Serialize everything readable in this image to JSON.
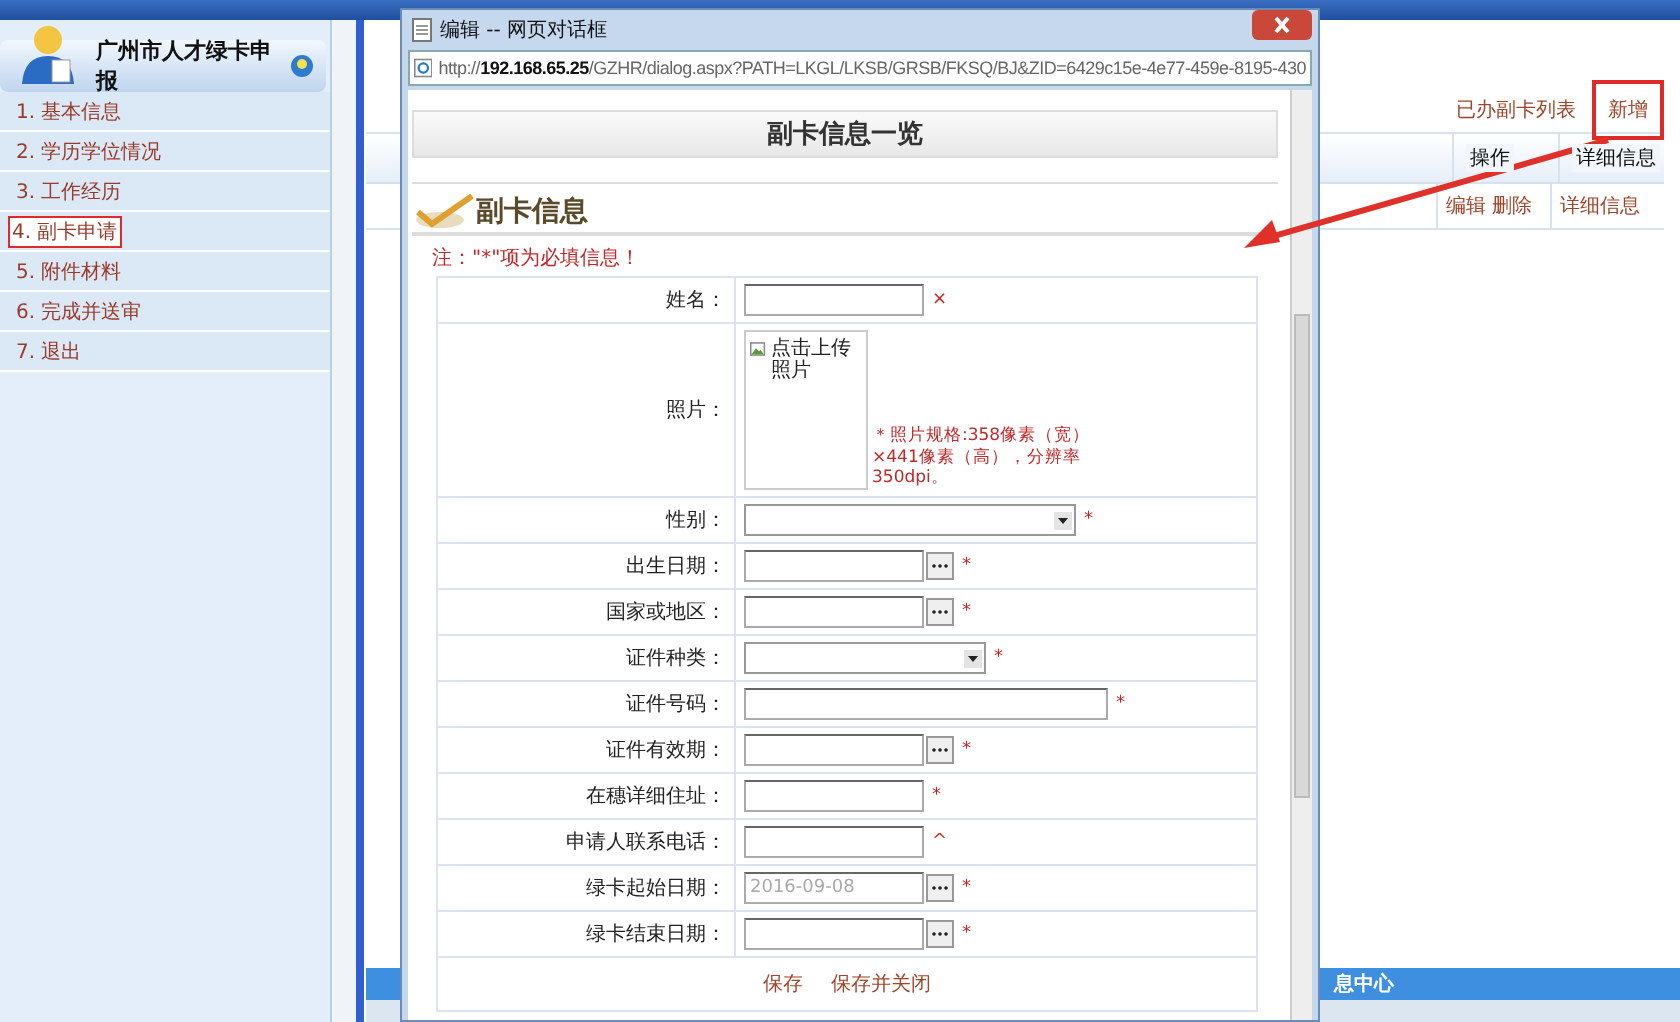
{
  "sidebar": {
    "title": "广州市人才绿卡申报",
    "items": [
      {
        "label": "1. 基本信息",
        "selected": false
      },
      {
        "label": "2. 学历学位情况",
        "selected": false
      },
      {
        "label": "3. 工作经历",
        "selected": false
      },
      {
        "label": "4. 副卡申请",
        "selected": true
      },
      {
        "label": "5. 附件材料",
        "selected": false
      },
      {
        "label": "6. 完成并送审",
        "selected": false
      },
      {
        "label": "7. 退出",
        "selected": false
      }
    ]
  },
  "main": {
    "list_title": "已办副卡列表",
    "add_link": "新增",
    "columns": [
      "操作",
      "详细信息"
    ],
    "rows": [
      {
        "actions": [
          "编辑",
          "删除"
        ],
        "detail": "详细信息"
      }
    ],
    "status_bar": "息中心"
  },
  "dialog": {
    "title": "编辑 -- 网页对话框",
    "address": "http://**192.168.65.25**/GZHR/dialog.aspx?PATH=LKGL/LKSB/GRSB/FKSQ/BJ&ZID=6429c15e-4e77-459e-8195-430",
    "heading": "副卡信息一览",
    "section": "副卡信息",
    "note": "注：\"*\"项为必填信息！",
    "fields": [
      {
        "label": "姓名：",
        "kind": "text",
        "marker": "×"
      },
      {
        "label": "照片：",
        "kind": "photo",
        "upload": "点击上传照片",
        "hint": "＊照片规格:358像素（宽）×441像素（高），分辨率350dpi。"
      },
      {
        "label": "性别：",
        "kind": "select",
        "marker": "*"
      },
      {
        "label": "出生日期：",
        "kind": "date",
        "marker": "*"
      },
      {
        "label": "国家或地区：",
        "kind": "date",
        "marker": "*"
      },
      {
        "label": "证件种类：",
        "kind": "shortselect",
        "marker": "*"
      },
      {
        "label": "证件号码：",
        "kind": "longtext",
        "marker": "*"
      },
      {
        "label": "证件有效期：",
        "kind": "date",
        "marker": "*"
      },
      {
        "label": "在穗详细住址：",
        "kind": "text",
        "marker": "*"
      },
      {
        "label": "申请人联系电话：",
        "kind": "text",
        "marker": "^"
      },
      {
        "label": "绿卡起始日期：",
        "kind": "date",
        "marker": "*",
        "value": "2016-09-08"
      },
      {
        "label": "绿卡结束日期：",
        "kind": "date",
        "marker": "*"
      }
    ],
    "buttons": [
      "保存",
      "保存并关闭"
    ]
  }
}
